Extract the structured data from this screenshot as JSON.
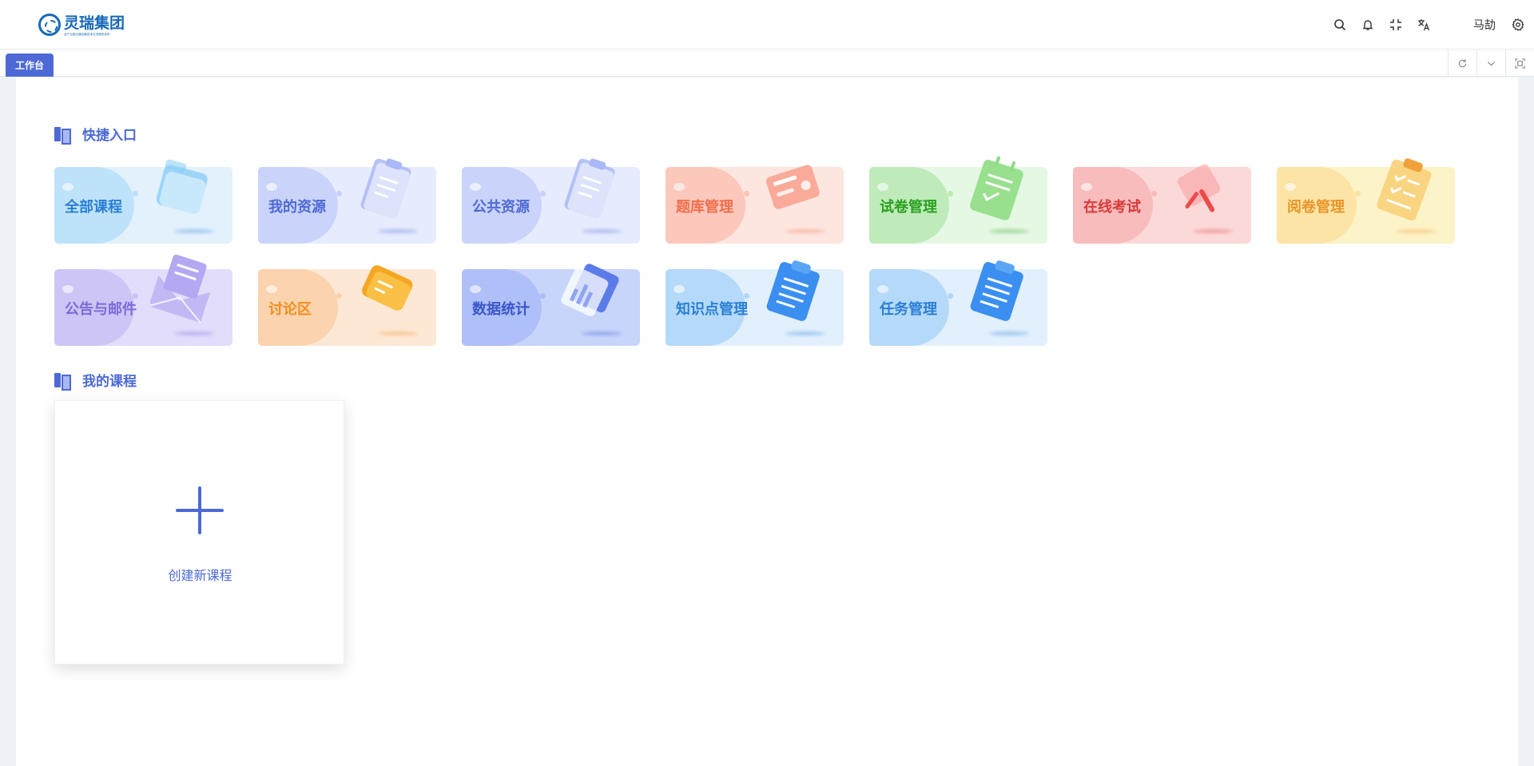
{
  "header": {
    "logo_name": "灵瑞集团",
    "logo_sub": "全产业链仪器设备技术交流服务体系",
    "user_name": "马劼",
    "icons": [
      "search-icon",
      "bell-icon",
      "fullscreen-icon",
      "translate-icon",
      "gear-icon"
    ]
  },
  "tabs": {
    "active_label": "工作台",
    "actions": [
      "refresh-icon",
      "chevron-down-icon",
      "maximize-icon"
    ]
  },
  "quick_entry": {
    "title": "快捷入口",
    "cards": [
      {
        "label": "全部课程",
        "color": "#2a7fd4",
        "bg": "#e3f1fd",
        "accent": "#8fd0f7",
        "icon": "folder-icon"
      },
      {
        "label": "我的资源",
        "color": "#4c69d6",
        "bg": "#e6ecfd",
        "accent": "#a9b8f6",
        "icon": "document-icon"
      },
      {
        "label": "公共资源",
        "color": "#4c69d6",
        "bg": "#e6ecfd",
        "accent": "#a9b8f6",
        "icon": "document-icon"
      },
      {
        "label": "题库管理",
        "color": "#ef6f4c",
        "bg": "#fde6df",
        "accent": "#f9a391",
        "icon": "card-icon"
      },
      {
        "label": "试卷管理",
        "color": "#2aa021",
        "bg": "#e5f8e4",
        "accent": "#8fdc84",
        "icon": "clipboard-icon"
      },
      {
        "label": "在线考试",
        "color": "#d93a3a",
        "bg": "#fcd9d9",
        "accent": "#f59a9a",
        "icon": "pen-icon"
      },
      {
        "label": "阅卷管理",
        "color": "#e8962a",
        "bg": "#fdf3c8",
        "accent": "#f8d27a",
        "icon": "checklist-icon"
      },
      {
        "label": "公告与邮件",
        "color": "#7a6bd8",
        "bg": "#e2ddfa",
        "accent": "#b3a8f1",
        "icon": "mail-icon"
      },
      {
        "label": "讨论区",
        "color": "#ef8f1d",
        "bg": "#fde8d6",
        "accent": "#f8bb7f",
        "icon": "chat-icon"
      },
      {
        "label": "数据统计",
        "color": "#3957c8",
        "bg": "#c8d5fb",
        "accent": "#90a5f1",
        "icon": "chart-icon"
      },
      {
        "label": "知识点管理",
        "color": "#2a7fd4",
        "bg": "#e2f0fd",
        "accent": "#7fbcf3",
        "icon": "list-icon"
      },
      {
        "label": "任务管理",
        "color": "#2a7fd4",
        "bg": "#e2f0fd",
        "accent": "#7fbcf3",
        "icon": "list-icon"
      }
    ]
  },
  "my_courses": {
    "title": "我的课程",
    "create_label": "创建新课程"
  }
}
